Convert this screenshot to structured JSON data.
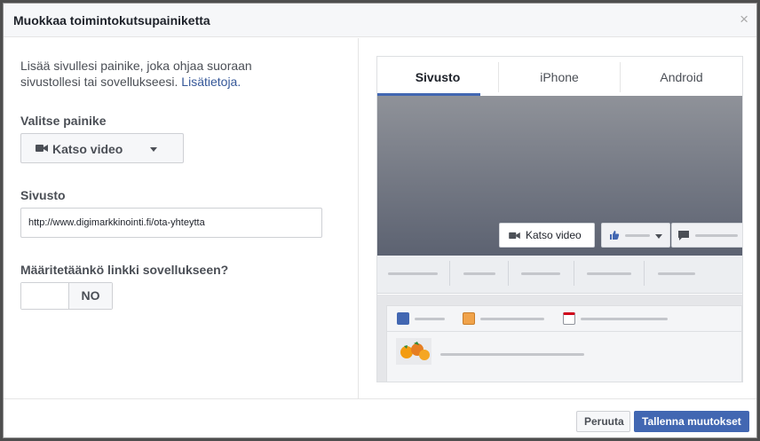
{
  "dialog": {
    "title": "Muokkaa toimintokutsupainiketta",
    "close_icon": "×"
  },
  "left": {
    "intro_text": "Lisää sivullesi painike, joka ohjaa suoraan sivustollesi tai sovellukseesi.",
    "intro_link": "Lisätietoja.",
    "button_label": "Valitse painike",
    "button_select_value": "Katso video",
    "website_label": "Sivusto",
    "website_value": "http://www.digimarkkinointi.fi/ota-yhteytta",
    "app_link_label": "Määritetäänkö linkki sovellukseen?",
    "app_link_toggle": "NO"
  },
  "preview": {
    "tabs": [
      {
        "label": "Sivusto"
      },
      {
        "label": "iPhone"
      },
      {
        "label": "Android"
      }
    ],
    "cta_label": "Katso video"
  },
  "footer": {
    "cancel_label": "Peruuta",
    "save_label": "Tallenna muutokset"
  },
  "colors": {
    "accent": "#4267b2",
    "link": "#365899"
  }
}
